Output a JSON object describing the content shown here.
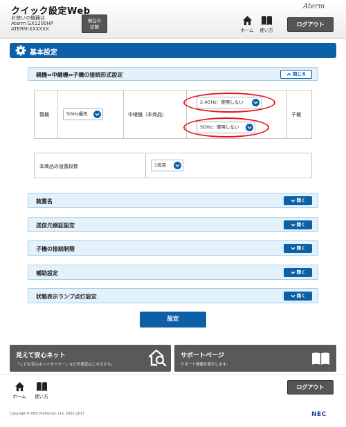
{
  "header": {
    "title": "クイック設定Web",
    "device_label": "お使いの機器は",
    "model": "Aterm GX1200HP",
    "device_id": "ATERM-XXXXXX",
    "status_button": "現在の\n状態",
    "brand": "Aterm",
    "home_label": "ホーム",
    "guide_label": "使い方",
    "logout_label": "ログアウト"
  },
  "section": {
    "title": "基本設定"
  },
  "connection": {
    "title": "親機⇔中継機⇔子機の接続形式設定",
    "toggle_label": "閉じる",
    "parent_label": "親機",
    "parent_select": "5GHz優先",
    "repeater_label": "中継機（本商品）",
    "band24_select": "2.4GHz：使用しない",
    "band5_select": "5GHz：使用しない",
    "child_label": "子機"
  },
  "stages": {
    "label": "本商品の設置段数",
    "select": "1段目"
  },
  "accordions": [
    {
      "title": "装置名",
      "button": "開く"
    },
    {
      "title": "送信元検証設定",
      "button": "開く"
    },
    {
      "title": "子機の接続制限",
      "button": "開く"
    },
    {
      "title": "補助設定",
      "button": "開く"
    },
    {
      "title": "状態表示ランプ点灯設定",
      "button": "開く"
    }
  ],
  "submit_label": "設定",
  "promos": [
    {
      "title": "見えて安心ネット",
      "desc": "「こども安心ネットタイマー」などの設定はこちらから。"
    },
    {
      "title": "サポートページ",
      "desc": "サポート情報を表示します。"
    }
  ],
  "footer": {
    "home_label": "ホーム",
    "guide_label": "使い方",
    "logout_label": "ログアウト",
    "copyright": "Copyright© NEC Platforms, Ltd. 2001-2017",
    "brand": "NEC"
  },
  "colors": {
    "accent": "#0d5fa8",
    "panel": "#e3f1fb",
    "highlight": "#e8141b",
    "dark_button": "#555555"
  }
}
